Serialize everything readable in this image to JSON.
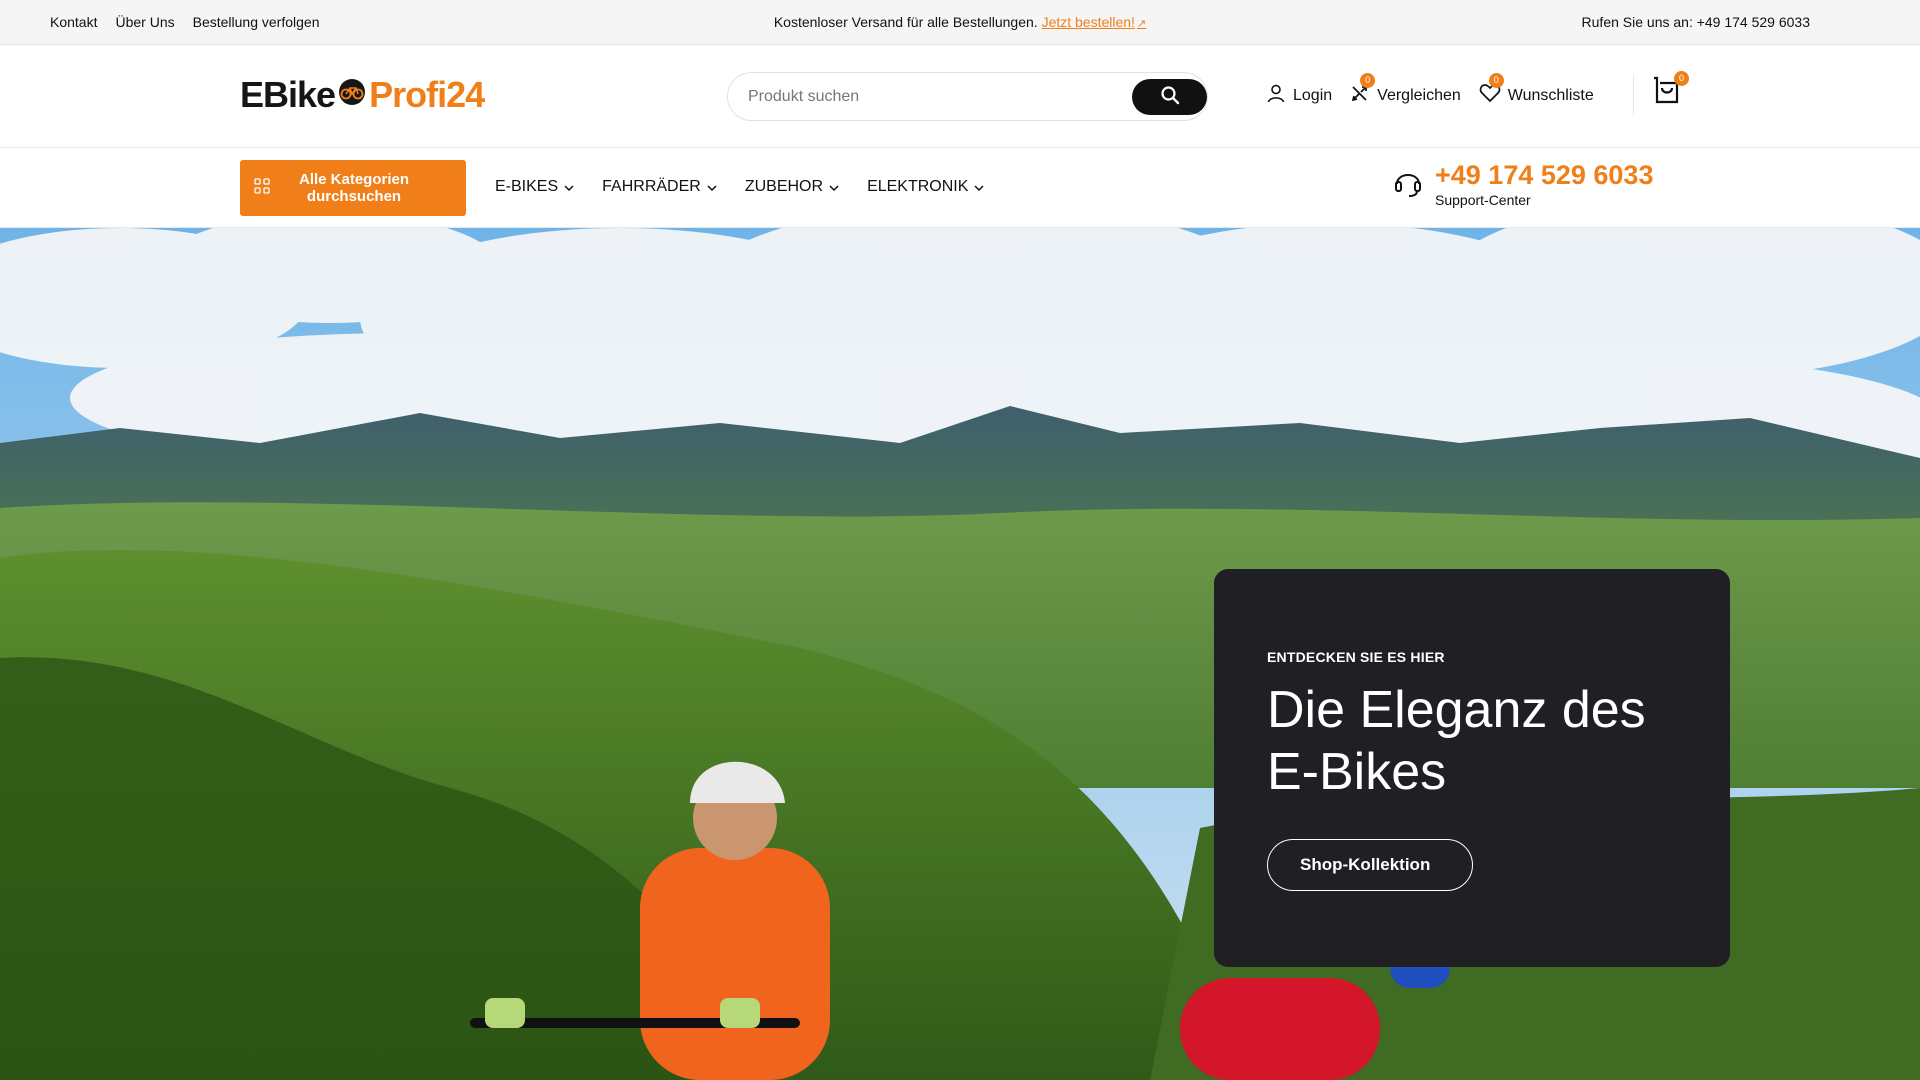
{
  "topbar": {
    "links": [
      "Kontakt",
      "Über Uns",
      "Bestellung verfolgen"
    ],
    "promo_text": "Kostenloser Versand für alle Bestellungen.",
    "promo_link": "Jetzt bestellen!",
    "promo_link_icon": "arrow-up-right-icon",
    "phone_text": "Rufen Sie uns an: +49 174 529 6033"
  },
  "header": {
    "logo_part1": "EBike",
    "logo_part2": "Profi24",
    "search": {
      "placeholder": "Produkt suchen"
    },
    "login_label": "Login",
    "compare_label": "Vergleichen",
    "compare_count": "0",
    "wishlist_label": "Wunschliste",
    "wishlist_count": "0",
    "cart_count": "0"
  },
  "nav": {
    "all_categories": "Alle Kategorien durchsuchen",
    "items": [
      "E-BIKES",
      "FAHRRÄDER",
      "ZUBEHOR",
      "ELEKTRONIK"
    ],
    "support_phone": "+49 174 529 6033",
    "support_label": "Support-Center"
  },
  "hero": {
    "eyebrow": "ENTDECKEN SIE ES HIER",
    "title": "Die Eleganz des E-Bikes",
    "cta": "Shop-Kollektion"
  },
  "colors": {
    "accent": "#f07f1a",
    "dark_card": "#1f1f24",
    "search_button": "#111111"
  }
}
